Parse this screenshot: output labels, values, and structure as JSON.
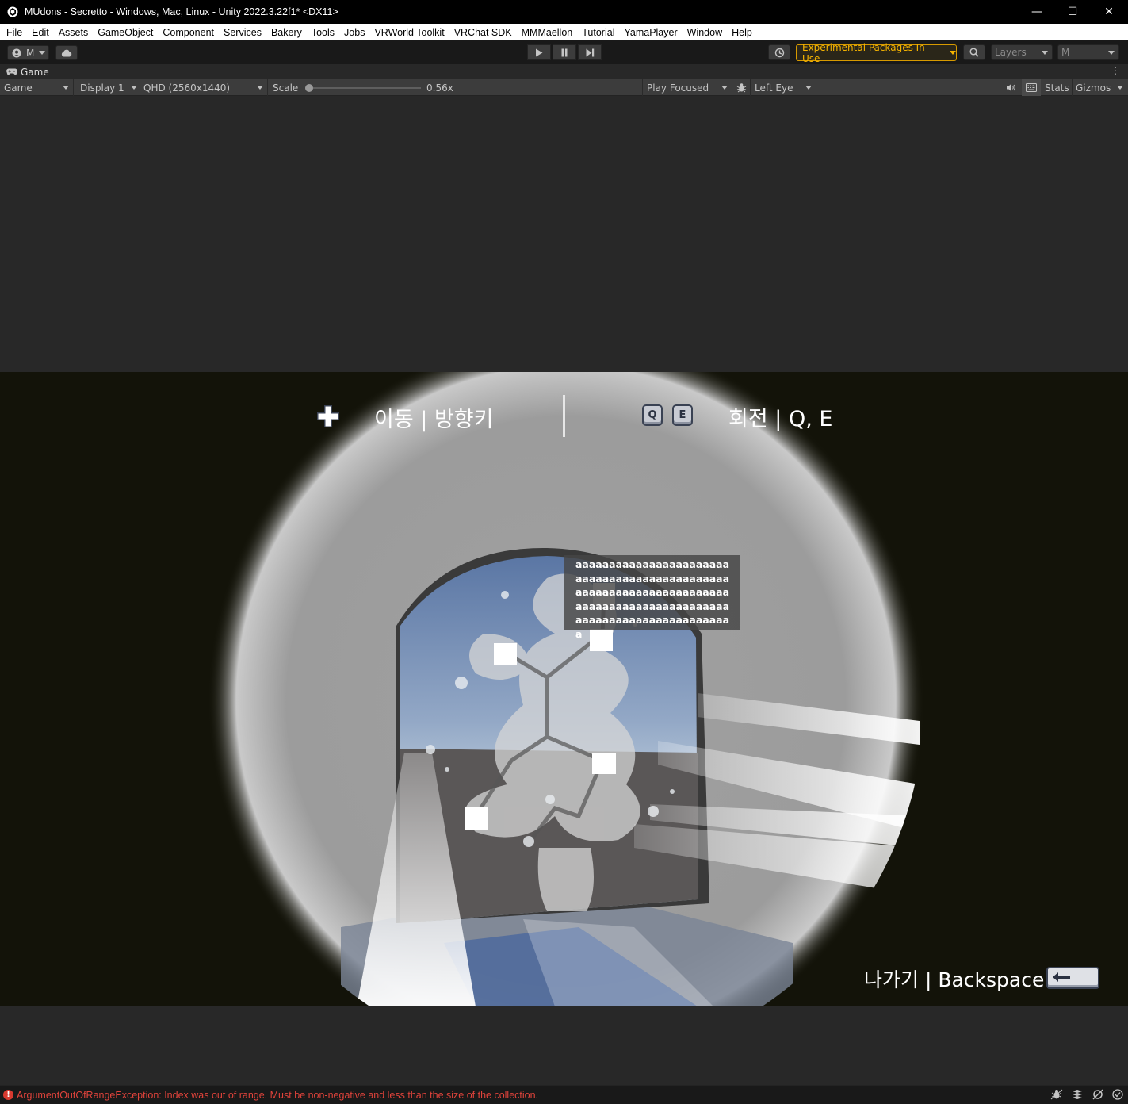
{
  "window": {
    "title": "MUdons - Secretto - Windows, Mac, Linux - Unity 2022.3.22f1* <DX11>",
    "controls": {
      "minimize": "—",
      "maximize": "☐",
      "close": "✕"
    }
  },
  "menu": [
    "File",
    "Edit",
    "Assets",
    "GameObject",
    "Component",
    "Services",
    "Bakery",
    "Tools",
    "Jobs",
    "VRWorld Toolkit",
    "VRChat SDK",
    "MMMaellon",
    "Tutorial",
    "YamaPlayer",
    "Window",
    "Help"
  ],
  "toolbar": {
    "account_label": "M",
    "experimental_label": "Experimental Packages In Use",
    "layers_label": "Layers",
    "layout_label": "M"
  },
  "tab": {
    "label": "Game"
  },
  "game_bar": {
    "view_mode": "Game",
    "display": "Display 1",
    "resolution": "QHD (2560x1440)",
    "scale_label": "Scale",
    "scale_value": "0.56x",
    "scale_fraction": 0.0,
    "play_mode": "Play Focused",
    "eye": "Left Eye",
    "stats": "Stats",
    "gizmos": "Gizmos"
  },
  "hud": {
    "move": "이동 | 방향키",
    "rotate": "회전 | Q, E",
    "key_q": "Q",
    "key_e": "E",
    "exit": "나가기 | Backspace"
  },
  "tooltip": {
    "text": "aaaaaaaaaaaaaaaaaaaaaaaaaaaaaaaaaaaaaaaaaaaaaaaaaaaaaaaaaaaaaaaaaaaaaaaaaaaaaaaaaaaaaaaaaaaaaaaaaaaaaaaaaaaaaaaaaaaa"
  },
  "status": {
    "message": "ArgumentOutOfRangeException: Index was out of range. Must be non-negative and less than the size of the collection."
  },
  "colors": {
    "accent_warning": "#f5b300",
    "error": "#e0433b"
  }
}
